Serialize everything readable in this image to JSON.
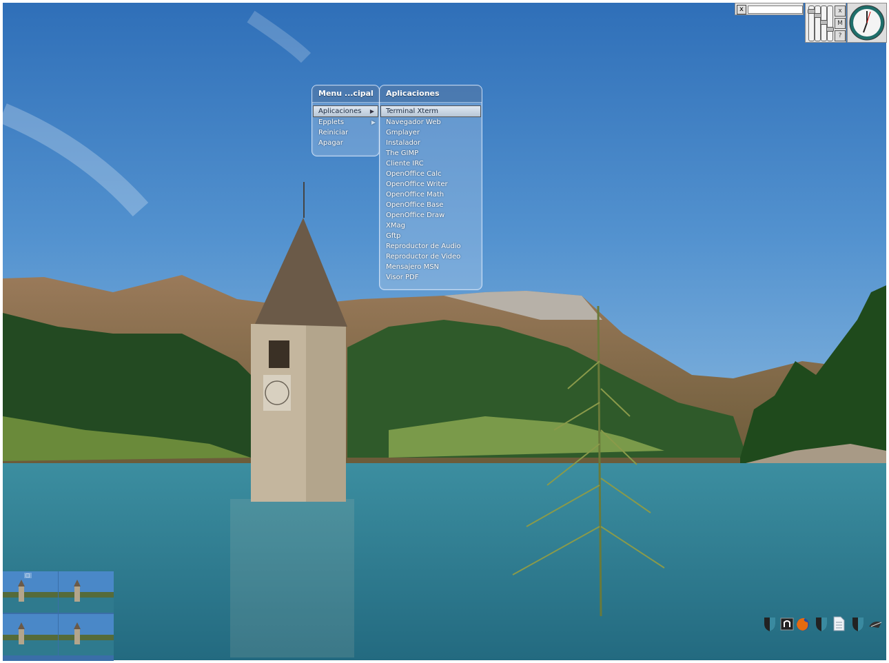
{
  "main_menu": {
    "title": "Menu ...cipal",
    "items": [
      {
        "label": "Aplicaciones",
        "submenu": true,
        "selected": true
      },
      {
        "label": "Epplets",
        "submenu": true,
        "selected": false
      },
      {
        "label": "Reiniciar",
        "submenu": false,
        "selected": false
      },
      {
        "label": "Apagar",
        "submenu": false,
        "selected": false
      }
    ]
  },
  "apps_menu": {
    "title": "Aplicaciones",
    "items": [
      {
        "label": "Terminal Xterm"
      },
      {
        "label": "Navegador Web"
      },
      {
        "label": "Gmplayer"
      },
      {
        "label": "Instalador"
      },
      {
        "label": "The GIMP"
      },
      {
        "label": "Cliente IRC"
      },
      {
        "label": "OpenOffice Calc"
      },
      {
        "label": "OpenOffice Writer"
      },
      {
        "label": "OpenOffice Math"
      },
      {
        "label": "OpenOffice Base"
      },
      {
        "label": "OpenOffice Draw"
      },
      {
        "label": "XMag"
      },
      {
        "label": "Gftp"
      },
      {
        "label": "Reproductor de Audio"
      },
      {
        "label": "Reproductor de Video"
      },
      {
        "label": "Mensajero MSN"
      },
      {
        "label": "Visor PDF"
      }
    ]
  },
  "dock": {
    "input_close": "x",
    "mixer_buttons": [
      "x",
      "M",
      "?"
    ],
    "clock_icon": "analog-clock-icon"
  },
  "tray": {
    "icons": [
      "shield-icon",
      "terminal-icon",
      "firefox-icon",
      "shield-icon",
      "document-icon",
      "shield-icon",
      "mail-icon"
    ]
  },
  "colors": {
    "sky": "#4a88c8",
    "lake": "#2f7a8e",
    "menu_text": "#ffffff"
  }
}
